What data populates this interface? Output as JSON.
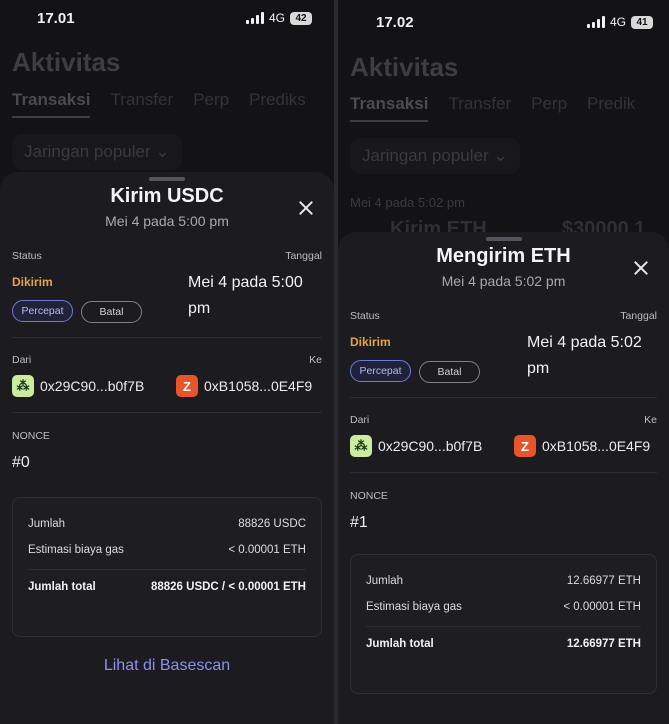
{
  "screens": [
    {
      "statusbar": {
        "time": "17.01",
        "network": "4G",
        "battery": "42"
      },
      "background": {
        "title": "Aktivitas",
        "tabs": [
          "Transaksi",
          "Transfer",
          "Perp",
          "Prediks"
        ],
        "filter": "Jaringan populer",
        "date_header": "",
        "row_label": "",
        "row_amount": ""
      },
      "sheet": {
        "title": "Kirim USDC",
        "subtitle": "Mei 4 pada 5:00 pm",
        "status_label": "Status",
        "date_label": "Tanggal",
        "status_value": "Dikirim",
        "speed_up_label": "Percepat",
        "cancel_label": "Batal",
        "date_value": "Mei 4 pada 5:00 pm",
        "from_label": "Dari",
        "to_label": "Ke",
        "from_address": "0x29C90...b0f7B",
        "to_address": "0xB1058...0E4F9",
        "nonce_label": "NONCE",
        "nonce_value": "#0",
        "amount_label": "Jumlah",
        "amount_value": "88826 USDC",
        "gas_label": "Estimasi biaya gas",
        "gas_value": "< 0.00001 ETH",
        "total_label": "Jumlah total",
        "total_value": "88826 USDC / < 0.00001 ETH",
        "explorer_link": "Lihat di Basescan"
      }
    },
    {
      "statusbar": {
        "time": "17.02",
        "network": "4G",
        "battery": "41"
      },
      "background": {
        "title": "Aktivitas",
        "tabs": [
          "Transaksi",
          "Transfer",
          "Perp",
          "Predik"
        ],
        "filter": "Jaringan populer",
        "date_header": "Mei 4 pada 5:02 pm",
        "row_label": "Kirim ETH",
        "row_amount": "$30000.1"
      },
      "sheet": {
        "title": "Mengirim ETH",
        "subtitle": "Mei 4 pada 5:02 pm",
        "status_label": "Status",
        "date_label": "Tanggal",
        "status_value": "Dikirim",
        "speed_up_label": "Percepat",
        "cancel_label": "Batal",
        "date_value": "Mei 4 pada 5:02 pm",
        "from_label": "Dari",
        "to_label": "Ke",
        "from_address": "0x29C90...b0f7B",
        "to_address": "0xB1058...0E4F9",
        "nonce_label": "NONCE",
        "nonce_value": "#1",
        "amount_label": "Jumlah",
        "amount_value": "12.66977 ETH",
        "gas_label": "Estimasi biaya gas",
        "gas_value": "< 0.00001 ETH",
        "total_label": "Jumlah total",
        "total_value": "12.66977 ETH",
        "explorer_link": ""
      }
    }
  ]
}
